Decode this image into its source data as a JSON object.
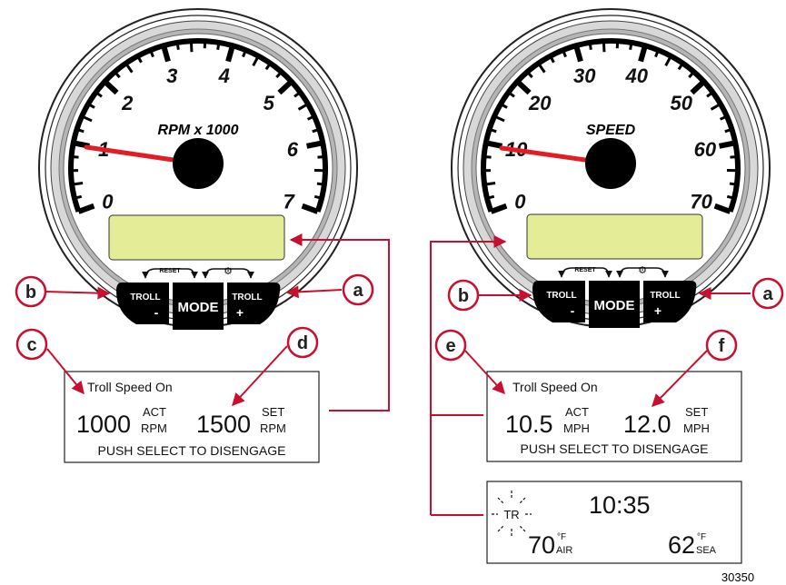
{
  "left_gauge": {
    "title": "RPM x 1000",
    "scale_labels": [
      "0",
      "1",
      "2",
      "3",
      "4",
      "5",
      "6",
      "7"
    ],
    "buttons": {
      "left_top": "TROLL",
      "left_sign": "-",
      "mode": "MODE",
      "right_top": "TROLL",
      "right_sign": "+",
      "reset": "RESET"
    }
  },
  "right_gauge": {
    "title": "SPEED",
    "scale_labels": [
      "0",
      "10",
      "20",
      "30",
      "40",
      "50",
      "60",
      "70"
    ],
    "buttons": {
      "left_top": "TROLL",
      "left_sign": "-",
      "mode": "MODE",
      "right_top": "TROLL",
      "right_sign": "+",
      "reset": "RESET"
    }
  },
  "callouts": {
    "a": "a",
    "b": "b",
    "c": "c",
    "d": "d",
    "e": "e",
    "f": "f"
  },
  "lcd_rpm": {
    "status": "Troll Speed On",
    "actual_value": "1000",
    "actual_top": "ACT",
    "actual_unit": "RPM",
    "set_value": "1500",
    "set_top": "SET",
    "set_unit": "RPM",
    "instruction": "PUSH SELECT TO DISENGAGE"
  },
  "lcd_speed": {
    "status": "Troll Speed On",
    "actual_value": "10.5",
    "actual_top": "ACT",
    "actual_unit": "MPH",
    "set_value": "12.0",
    "set_top": "SET",
    "set_unit": "MPH",
    "instruction": "PUSH SELECT TO DISENGAGE"
  },
  "lcd_summary": {
    "indicator": "TR",
    "time": "10:35",
    "air_temp": "70",
    "air_unit_top": "°F",
    "air_label": "AIR",
    "sea_temp": "62",
    "sea_unit_top": "°F",
    "sea_label": "SEA"
  },
  "figure_number": "30350",
  "colors": {
    "arrow_red": "#c8102e",
    "needle_red": "#e31b23",
    "lcd_green": "#e4ec98",
    "callout_circle_fill": "#ffffff"
  }
}
